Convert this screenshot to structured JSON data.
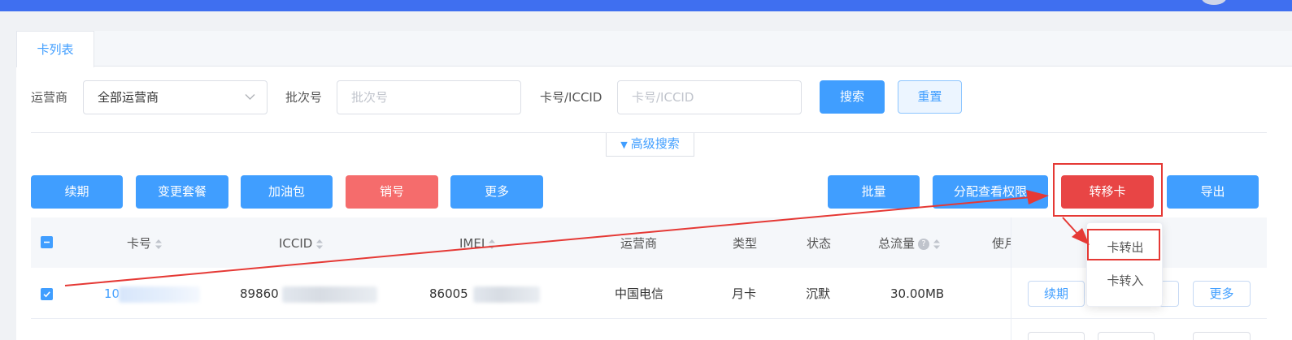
{
  "tabs": [
    {
      "label": "卡列表",
      "active": true
    }
  ],
  "filters": {
    "operator_label": "运营商",
    "operator_value": "全部运营商",
    "batch_label": "批次号",
    "batch_placeholder": "批次号",
    "iccid_label": "卡号/ICCID",
    "iccid_placeholder": "卡号/ICCID",
    "search_button": "搜索",
    "reset_button": "重置",
    "advanced_search": "高级搜索"
  },
  "toolbar": {
    "left": [
      "续期",
      "变更套餐",
      "加油包",
      "销号",
      "更多"
    ],
    "right": [
      "批量",
      "分配查看权限",
      "转移卡",
      "导出"
    ]
  },
  "transfer_menu": {
    "items": [
      "卡转出",
      "卡转入"
    ],
    "highlighted": "卡转出"
  },
  "table": {
    "headers": {
      "card_no": "卡号",
      "iccid": "ICCID",
      "imei": "IMEI",
      "operator": "运营商",
      "type": "类型",
      "status": "状态",
      "total_traffic": "总流量",
      "usage": "使月",
      "help_glyph": "?"
    },
    "rows": [
      {
        "checked": true,
        "card_no": "10",
        "iccid": "89860",
        "imei": "86005",
        "operator": "中国电信",
        "type": "月卡",
        "status": "沉默",
        "total_traffic": "30.00MB",
        "actions": [
          "续期",
          "更多"
        ]
      }
    ]
  },
  "colors": {
    "primary": "#409eff",
    "danger": "#f56c6c",
    "danger_dark": "#e84545",
    "annotation": "#e53935",
    "topbar": "#3f6ff0"
  },
  "icons": [
    "chevron-down-icon",
    "caret-down-icon",
    "sort-icon",
    "help-icon",
    "check-icon",
    "minus-icon"
  ]
}
